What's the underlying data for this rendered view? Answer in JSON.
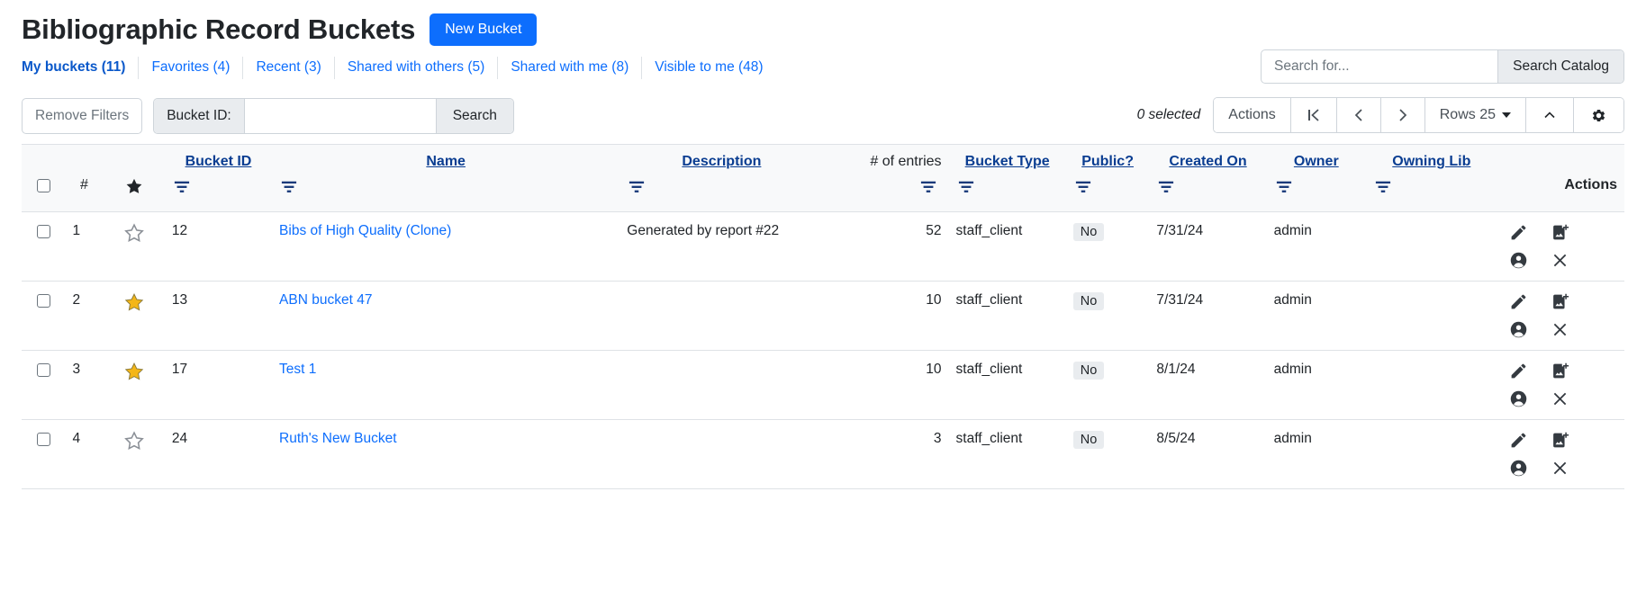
{
  "header": {
    "title": "Bibliographic Record Buckets",
    "new_bucket_label": "New Bucket"
  },
  "nav": {
    "items": [
      {
        "label": "My buckets (11)",
        "active": true
      },
      {
        "label": "Favorites (4)",
        "active": false
      },
      {
        "label": "Recent (3)",
        "active": false
      },
      {
        "label": "Shared with others (5)",
        "active": false
      },
      {
        "label": "Shared with me (8)",
        "active": false
      },
      {
        "label": "Visible to me (48)",
        "active": false
      }
    ]
  },
  "catalog_search": {
    "placeholder": "Search for...",
    "value": "",
    "button_label": "Search Catalog"
  },
  "toolbar": {
    "remove_filters_label": "Remove Filters",
    "bucket_id_label": "Bucket ID:",
    "bucket_id_value": "",
    "bucket_id_placeholder": "",
    "search_label": "Search",
    "selected_text": "0 selected",
    "actions_label": "Actions",
    "first_page_label": "|<",
    "prev_page_label": "‹",
    "next_page_label": "›",
    "rows_label": "Rows 25",
    "collapse_label": "^",
    "gear_label": "gear"
  },
  "table": {
    "columns": [
      {
        "key": "checkbox",
        "label": "",
        "sortable": false,
        "filter": false,
        "align": "center"
      },
      {
        "key": "num",
        "label": "#",
        "sortable": false,
        "filter": false,
        "align": "left"
      },
      {
        "key": "fav",
        "label": "★",
        "sortable": false,
        "filter": false,
        "align": "center"
      },
      {
        "key": "bucket_id",
        "label": "Bucket ID",
        "sortable": true,
        "filter": true,
        "align": "left"
      },
      {
        "key": "name",
        "label": "Name",
        "sortable": true,
        "filter": true,
        "align": "left"
      },
      {
        "key": "description",
        "label": "Description",
        "sortable": true,
        "filter": true,
        "align": "left"
      },
      {
        "key": "entries",
        "label": "# of entries",
        "sortable": false,
        "filter": true,
        "align": "right"
      },
      {
        "key": "bucket_type",
        "label": "Bucket Type",
        "sortable": true,
        "filter": true,
        "align": "left"
      },
      {
        "key": "public",
        "label": "Public?",
        "sortable": true,
        "filter": true,
        "align": "left"
      },
      {
        "key": "created_on",
        "label": "Created On",
        "sortable": true,
        "filter": true,
        "align": "left"
      },
      {
        "key": "owner",
        "label": "Owner",
        "sortable": true,
        "filter": true,
        "align": "left"
      },
      {
        "key": "owning_lib",
        "label": "Owning Lib",
        "sortable": true,
        "filter": true,
        "align": "left"
      },
      {
        "key": "actions",
        "label": "Actions",
        "sortable": false,
        "filter": false,
        "align": "right"
      }
    ],
    "actions_header": "Actions",
    "row_actions": [
      {
        "name": "edit-bucket",
        "icon": "pencil-icon"
      },
      {
        "name": "add-to-bucket",
        "icon": "image-add-icon"
      },
      {
        "name": "share-bucket",
        "icon": "person-icon"
      },
      {
        "name": "delete-bucket",
        "icon": "close-icon"
      }
    ],
    "rows": [
      {
        "num": "1",
        "favorite": false,
        "bucket_id": "12",
        "name": "Bibs of High Quality (Clone)",
        "description": "Generated by report #22",
        "entries": "52",
        "bucket_type": "staff_client",
        "public": "No",
        "created_on": "7/31/24",
        "owner": "admin",
        "owning_lib": ""
      },
      {
        "num": "2",
        "favorite": true,
        "bucket_id": "13",
        "name": "ABN bucket 47",
        "description": "",
        "entries": "10",
        "bucket_type": "staff_client",
        "public": "No",
        "created_on": "7/31/24",
        "owner": "admin",
        "owning_lib": ""
      },
      {
        "num": "3",
        "favorite": true,
        "bucket_id": "17",
        "name": "Test 1",
        "description": "",
        "entries": "10",
        "bucket_type": "staff_client",
        "public": "No",
        "created_on": "8/1/24",
        "owner": "admin",
        "owning_lib": ""
      },
      {
        "num": "4",
        "favorite": false,
        "bucket_id": "24",
        "name": "Ruth's New Bucket",
        "description": "",
        "entries": "3",
        "bucket_type": "staff_client",
        "public": "No",
        "created_on": "8/5/24",
        "owner": "admin",
        "owning_lib": ""
      }
    ]
  },
  "colors": {
    "primary": "#0d6efd",
    "link": "#0d6efd",
    "header_link": "#0a3d91",
    "favorite_star": "#f4b618",
    "header_bg": "#f8f9fa",
    "border": "#dee2e6",
    "muted": "#6c757d"
  }
}
